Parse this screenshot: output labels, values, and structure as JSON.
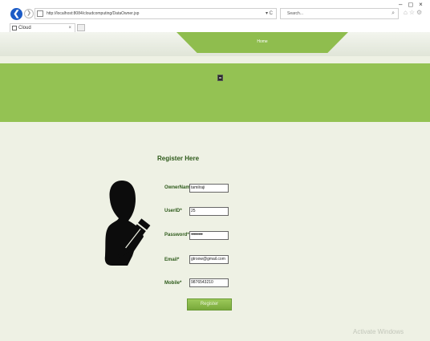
{
  "browser": {
    "address": "http://localhost:8084/cloudcomputing/DataOwner.jsp",
    "search_placeholder": "Search...",
    "tab_title": "Cloud"
  },
  "nav": {
    "home_label": "Home"
  },
  "form": {
    "title": "Register Here",
    "fields": [
      {
        "label": "OwnerName *",
        "value": "tamilraji"
      },
      {
        "label": "UserID*",
        "value": "25"
      },
      {
        "label": "Password*",
        "value": "•••••••••"
      },
      {
        "label": "Email*",
        "value": "gtroow@gmail.com"
      },
      {
        "label": "Mobile*",
        "value": "9876543210"
      }
    ],
    "submit_label": "Register"
  },
  "system": {
    "watermark": "Activate Windows"
  },
  "colors": {
    "accent": "#94c253",
    "label": "#2d5a1a"
  }
}
